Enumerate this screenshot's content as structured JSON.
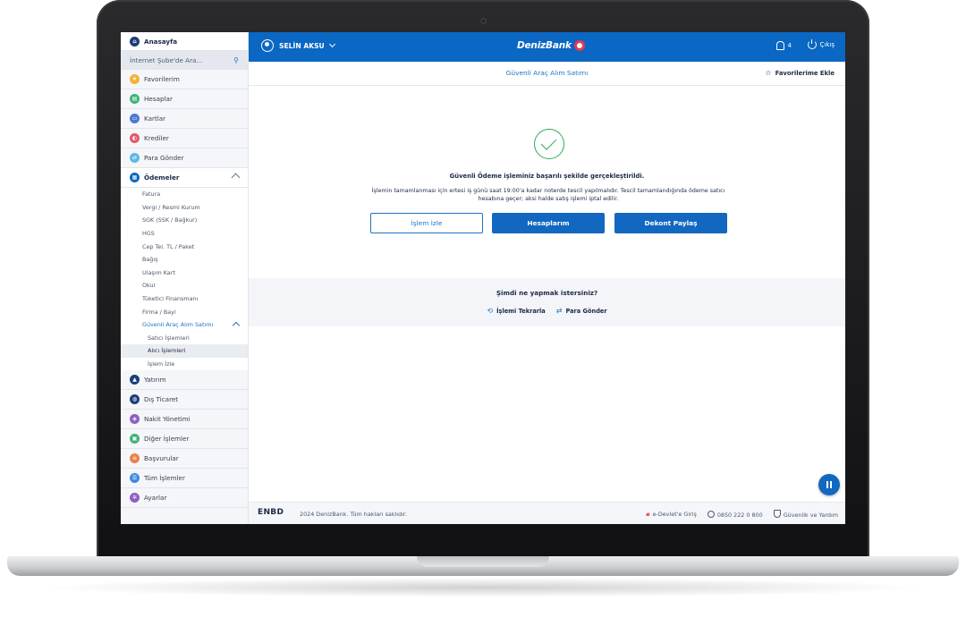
{
  "header": {
    "user_name": "SELİN AKSU",
    "brand": "DenizBank",
    "notification_count": "4",
    "logout_label": "Çıkış"
  },
  "sidebar": {
    "home_label": "Anasayfa",
    "search_placeholder": "İnternet Şube'de Ara...",
    "items": [
      {
        "label": "Favorilerim",
        "color": "#f5b335"
      },
      {
        "label": "Hesaplar",
        "color": "#3fb37a"
      },
      {
        "label": "Kartlar",
        "color": "#4f78d1"
      },
      {
        "label": "Krediler",
        "color": "#e4576b"
      },
      {
        "label": "Para Gönder",
        "color": "#5fb8e8"
      }
    ],
    "payments": {
      "label": "Ödemeler",
      "color": "#0a67c3",
      "sub_items": [
        "Fatura",
        "Vergi / Resmi Kurum",
        "SGK (SSK / Bağkur)",
        "HGS",
        "Cep Tel. TL / Paket",
        "Bağış",
        "Ulaşım Kart",
        "Okul",
        "Tüketici Finansmanı",
        "Firma / Bayi"
      ],
      "vehicle_group": "Güvenli Araç Alım Satımı",
      "vehicle_items": [
        "Satıcı İşlemleri",
        "Alıcı İşlemleri"
      ],
      "track_item": "İşlem İzle"
    },
    "bottom_items": [
      {
        "label": "Yatırım",
        "color": "#1c3e78"
      },
      {
        "label": "Dış Ticaret",
        "color": "#1c3e78"
      },
      {
        "label": "Nakit Yönetimi",
        "color": "#8e5fc4"
      },
      {
        "label": "Diğer İşlemler",
        "color": "#3fb37a"
      },
      {
        "label": "Başvurular",
        "color": "#e8834a"
      },
      {
        "label": "Tüm İşlemler",
        "color": "#3a8be0"
      },
      {
        "label": "Ayarlar",
        "color": "#8e5fc4"
      }
    ]
  },
  "subheader": {
    "title": "Güvenli Araç Alım Satımı",
    "favorite_label": "Favorilerime Ekle"
  },
  "result": {
    "success_message": "Güvenli Ödeme işleminiz başarılı şekilde gerçekleştirildi.",
    "note": "İşlemin tamamlanması için ertesi iş günü saat 19:00'a kadar noterde tescil yapılmalıdır. Tescil tamamlandığında ödeme satıcı hesabına geçer; aksi halde satış işlemi iptal edilir.",
    "buttons": {
      "track": "İşlem İzle",
      "accounts": "Hesaplarım",
      "share": "Dekont Paylaş"
    }
  },
  "next_steps": {
    "question": "Şimdi ne yapmak istersiniz?",
    "repeat_label": "İşlemi Tekrarla",
    "send_label": "Para Gönder"
  },
  "footer": {
    "logo": "ENBD",
    "copyright": "2024 DenizBank. Tüm hakları saklıdır.",
    "edevlet": "e-Devlet'e Giriş",
    "phone": "0850 222 0 800",
    "security": "Güvenlik ve Yardım"
  }
}
